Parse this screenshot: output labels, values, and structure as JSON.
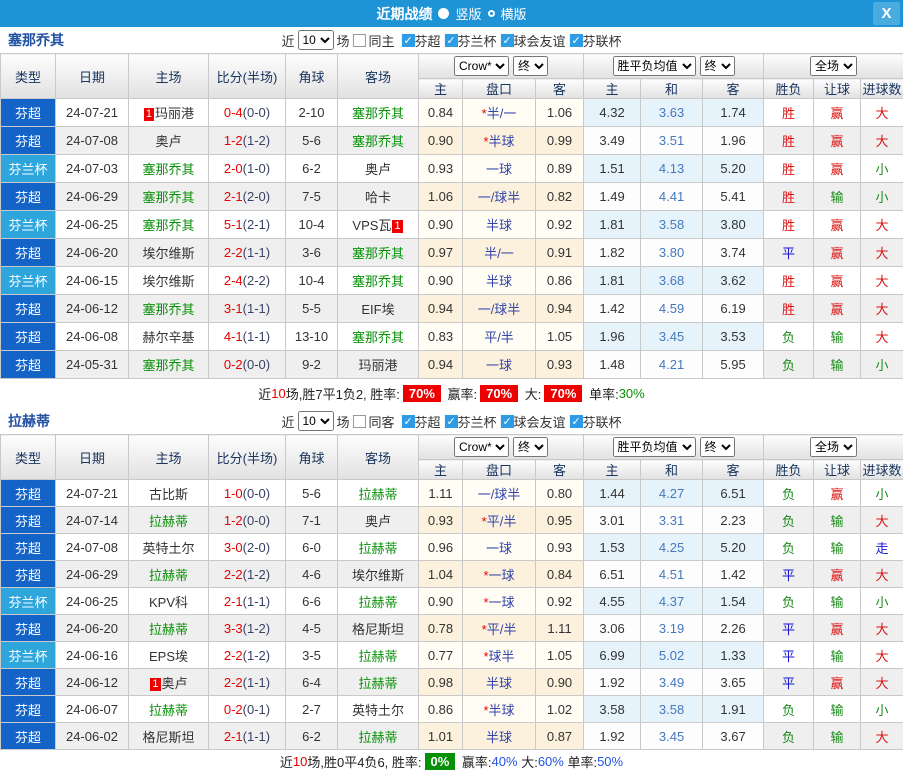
{
  "titlebar": {
    "title": "近期战绩",
    "radios": [
      {
        "label": "竖版",
        "selected": true
      },
      {
        "label": "横版",
        "selected": false
      }
    ],
    "close_label": "X"
  },
  "table_header": {
    "cols": [
      "类型",
      "日期",
      "主场",
      "比分(半场)",
      "角球",
      "客场"
    ],
    "sub": [
      "主",
      "盘口",
      "客",
      "主",
      "和",
      "客",
      "胜负",
      "让球",
      "进球数"
    ],
    "selects": {
      "company": "Crow*",
      "company_state": "终",
      "avg": "胜平负均值",
      "avg_state": "终",
      "scope": "全场"
    }
  },
  "colors": {
    "league_deep": "#1464c8",
    "league_light": "#2ea6dc",
    "self_team_green": "#089008",
    "win_red": "#dc1414",
    "draw_blue": "#1414d2",
    "lose_green": "#1a8a1a",
    "titlebar_blue": "#1e93d6"
  },
  "sections": [
    {
      "team": "塞那乔其",
      "filters": {
        "prefix": "近",
        "count": "10",
        "suffix": "场",
        "same_label": "同主",
        "same_checked": false,
        "leagues": [
          {
            "label": "芬超",
            "checked": true
          },
          {
            "label": "芬兰杯",
            "checked": true
          },
          {
            "label": "球会友谊",
            "checked": true
          },
          {
            "label": "芬联杯",
            "checked": true
          }
        ]
      },
      "rows": [
        {
          "league": "芬超",
          "league_type": "deep",
          "date": "24-07-21",
          "home": {
            "name": "玛丽港",
            "self": false,
            "badge": "1",
            "badge_pos": "before"
          },
          "score": "0-4",
          "half": "(0-0)",
          "corner": "2-10",
          "away": {
            "name": "塞那乔其",
            "self": true
          },
          "odds": [
            "0.84",
            "*半/一",
            "1.06"
          ],
          "avg": [
            "4.32",
            "3.63",
            "1.74"
          ],
          "results": [
            {
              "t": "胜",
              "c": "red"
            },
            {
              "t": "赢",
              "c": "red"
            },
            {
              "t": "大",
              "c": "red"
            }
          ]
        },
        {
          "league": "芬超",
          "league_type": "deep",
          "date": "24-07-08",
          "home": {
            "name": "奥卢",
            "self": false
          },
          "score": "1-2",
          "half": "(1-2)",
          "corner": "5-6",
          "away": {
            "name": "塞那乔其",
            "self": true
          },
          "odds": [
            "0.90",
            "*半球",
            "0.99"
          ],
          "avg": [
            "3.49",
            "3.51",
            "1.96"
          ],
          "results": [
            {
              "t": "胜",
              "c": "red"
            },
            {
              "t": "赢",
              "c": "red"
            },
            {
              "t": "大",
              "c": "red"
            }
          ]
        },
        {
          "league": "芬兰杯",
          "league_type": "light",
          "date": "24-07-03",
          "home": {
            "name": "塞那乔其",
            "self": true
          },
          "score": "2-0",
          "half": "(1-0)",
          "corner": "6-2",
          "away": {
            "name": "奥卢",
            "self": false
          },
          "odds": [
            "0.93",
            "一球",
            "0.89"
          ],
          "avg": [
            "1.51",
            "4.13",
            "5.20"
          ],
          "results": [
            {
              "t": "胜",
              "c": "red"
            },
            {
              "t": "赢",
              "c": "red"
            },
            {
              "t": "小",
              "c": "green"
            }
          ]
        },
        {
          "league": "芬超",
          "league_type": "deep",
          "date": "24-06-29",
          "home": {
            "name": "塞那乔其",
            "self": true
          },
          "score": "2-1",
          "half": "(2-0)",
          "corner": "7-5",
          "away": {
            "name": "哈卡",
            "self": false
          },
          "odds": [
            "1.06",
            "一/球半",
            "0.82"
          ],
          "avg": [
            "1.49",
            "4.41",
            "5.41"
          ],
          "results": [
            {
              "t": "胜",
              "c": "red"
            },
            {
              "t": "输",
              "c": "green"
            },
            {
              "t": "小",
              "c": "green"
            }
          ]
        },
        {
          "league": "芬兰杯",
          "league_type": "light",
          "date": "24-06-25",
          "home": {
            "name": "塞那乔其",
            "self": true
          },
          "score": "5-1",
          "half": "(2-1)",
          "corner": "10-4",
          "away": {
            "name": "VPS瓦",
            "self": false,
            "badge": "1",
            "badge_pos": "after"
          },
          "odds": [
            "0.90",
            "半球",
            "0.92"
          ],
          "avg": [
            "1.81",
            "3.58",
            "3.80"
          ],
          "results": [
            {
              "t": "胜",
              "c": "red"
            },
            {
              "t": "赢",
              "c": "red"
            },
            {
              "t": "大",
              "c": "red"
            }
          ]
        },
        {
          "league": "芬超",
          "league_type": "deep",
          "date": "24-06-20",
          "home": {
            "name": "埃尔维斯",
            "self": false
          },
          "score": "2-2",
          "half": "(1-1)",
          "corner": "3-6",
          "away": {
            "name": "塞那乔其",
            "self": true
          },
          "odds": [
            "0.97",
            "半/一",
            "0.91"
          ],
          "avg": [
            "1.82",
            "3.80",
            "3.74"
          ],
          "results": [
            {
              "t": "平",
              "c": "blue"
            },
            {
              "t": "赢",
              "c": "red"
            },
            {
              "t": "大",
              "c": "red"
            }
          ]
        },
        {
          "league": "芬兰杯",
          "league_type": "light",
          "date": "24-06-15",
          "home": {
            "name": "埃尔维斯",
            "self": false
          },
          "score": "2-4",
          "half": "(2-2)",
          "corner": "10-4",
          "away": {
            "name": "塞那乔其",
            "self": true
          },
          "odds": [
            "0.90",
            "半球",
            "0.86"
          ],
          "avg": [
            "1.81",
            "3.68",
            "3.62"
          ],
          "results": [
            {
              "t": "胜",
              "c": "red"
            },
            {
              "t": "赢",
              "c": "red"
            },
            {
              "t": "大",
              "c": "red"
            }
          ]
        },
        {
          "league": "芬超",
          "league_type": "deep",
          "date": "24-06-12",
          "home": {
            "name": "塞那乔其",
            "self": true
          },
          "score": "3-1",
          "half": "(1-1)",
          "corner": "5-5",
          "away": {
            "name": "EIF埃",
            "self": false
          },
          "odds": [
            "0.94",
            "一/球半",
            "0.94"
          ],
          "avg": [
            "1.42",
            "4.59",
            "6.19"
          ],
          "results": [
            {
              "t": "胜",
              "c": "red"
            },
            {
              "t": "赢",
              "c": "red"
            },
            {
              "t": "大",
              "c": "red"
            }
          ]
        },
        {
          "league": "芬超",
          "league_type": "deep",
          "date": "24-06-08",
          "home": {
            "name": "赫尔辛基",
            "self": false
          },
          "score": "4-1",
          "half": "(1-1)",
          "corner": "13-10",
          "away": {
            "name": "塞那乔其",
            "self": true
          },
          "odds": [
            "0.83",
            "平/半",
            "1.05"
          ],
          "avg": [
            "1.96",
            "3.45",
            "3.53"
          ],
          "results": [
            {
              "t": "负",
              "c": "green"
            },
            {
              "t": "输",
              "c": "green"
            },
            {
              "t": "大",
              "c": "red"
            }
          ]
        },
        {
          "league": "芬超",
          "league_type": "deep",
          "date": "24-05-31",
          "home": {
            "name": "塞那乔其",
            "self": true
          },
          "score": "0-2",
          "half": "(0-0)",
          "corner": "9-2",
          "away": {
            "name": "玛丽港",
            "self": false
          },
          "odds": [
            "0.94",
            "一球",
            "0.93"
          ],
          "avg": [
            "1.48",
            "4.21",
            "5.95"
          ],
          "results": [
            {
              "t": "负",
              "c": "green"
            },
            {
              "t": "输",
              "c": "green"
            },
            {
              "t": "小",
              "c": "green"
            }
          ]
        }
      ],
      "summary": [
        {
          "t": "近"
        },
        {
          "t": "10",
          "c": "red"
        },
        {
          "t": "场,胜7平1负2, 胜率:"
        },
        {
          "t": "70%",
          "c": "badge-red"
        },
        {
          "t": " 赢率:"
        },
        {
          "t": "70%",
          "c": "badge-red"
        },
        {
          "t": " 大:"
        },
        {
          "t": "70%",
          "c": "badge-red"
        },
        {
          "t": " 单率:"
        },
        {
          "t": "30%",
          "c": "green"
        }
      ]
    },
    {
      "team": "拉赫蒂",
      "filters": {
        "prefix": "近",
        "count": "10",
        "suffix": "场",
        "same_label": "同客",
        "same_checked": false,
        "leagues": [
          {
            "label": "芬超",
            "checked": true
          },
          {
            "label": "芬兰杯",
            "checked": true
          },
          {
            "label": "球会友谊",
            "checked": true
          },
          {
            "label": "芬联杯",
            "checked": true
          }
        ]
      },
      "rows": [
        {
          "league": "芬超",
          "league_type": "deep",
          "date": "24-07-21",
          "home": {
            "name": "古比斯",
            "self": false
          },
          "score": "1-0",
          "half": "(0-0)",
          "corner": "5-6",
          "away": {
            "name": "拉赫蒂",
            "self": true
          },
          "odds": [
            "1.11",
            "一/球半",
            "0.80"
          ],
          "avg": [
            "1.44",
            "4.27",
            "6.51"
          ],
          "results": [
            {
              "t": "负",
              "c": "green"
            },
            {
              "t": "赢",
              "c": "red"
            },
            {
              "t": "小",
              "c": "green"
            }
          ]
        },
        {
          "league": "芬超",
          "league_type": "deep",
          "date": "24-07-14",
          "home": {
            "name": "拉赫蒂",
            "self": true
          },
          "score": "1-2",
          "half": "(0-0)",
          "corner": "7-1",
          "away": {
            "name": "奥卢",
            "self": false
          },
          "odds": [
            "0.93",
            "*平/半",
            "0.95"
          ],
          "avg": [
            "3.01",
            "3.31",
            "2.23"
          ],
          "results": [
            {
              "t": "负",
              "c": "green"
            },
            {
              "t": "输",
              "c": "green"
            },
            {
              "t": "大",
              "c": "red"
            }
          ]
        },
        {
          "league": "芬超",
          "league_type": "deep",
          "date": "24-07-08",
          "home": {
            "name": "英特土尔",
            "self": false
          },
          "score": "3-0",
          "half": "(2-0)",
          "corner": "6-0",
          "away": {
            "name": "拉赫蒂",
            "self": true
          },
          "odds": [
            "0.96",
            "一球",
            "0.93"
          ],
          "avg": [
            "1.53",
            "4.25",
            "5.20"
          ],
          "results": [
            {
              "t": "负",
              "c": "green"
            },
            {
              "t": "输",
              "c": "green"
            },
            {
              "t": "走",
              "c": "blue"
            }
          ]
        },
        {
          "league": "芬超",
          "league_type": "deep",
          "date": "24-06-29",
          "home": {
            "name": "拉赫蒂",
            "self": true
          },
          "score": "2-2",
          "half": "(1-2)",
          "corner": "4-6",
          "away": {
            "name": "埃尔维斯",
            "self": false
          },
          "odds": [
            "1.04",
            "*一球",
            "0.84"
          ],
          "avg": [
            "6.51",
            "4.51",
            "1.42"
          ],
          "results": [
            {
              "t": "平",
              "c": "blue"
            },
            {
              "t": "赢",
              "c": "red"
            },
            {
              "t": "大",
              "c": "red"
            }
          ]
        },
        {
          "league": "芬兰杯",
          "league_type": "light",
          "date": "24-06-25",
          "home": {
            "name": "KPV科",
            "self": false
          },
          "score": "2-1",
          "half": "(1-1)",
          "corner": "6-6",
          "away": {
            "name": "拉赫蒂",
            "self": true
          },
          "odds": [
            "0.90",
            "*一球",
            "0.92"
          ],
          "avg": [
            "4.55",
            "4.37",
            "1.54"
          ],
          "results": [
            {
              "t": "负",
              "c": "green"
            },
            {
              "t": "输",
              "c": "green"
            },
            {
              "t": "小",
              "c": "green"
            }
          ]
        },
        {
          "league": "芬超",
          "league_type": "deep",
          "date": "24-06-20",
          "home": {
            "name": "拉赫蒂",
            "self": true
          },
          "score": "3-3",
          "half": "(1-2)",
          "corner": "4-5",
          "away": {
            "name": "格尼斯坦",
            "self": false
          },
          "odds": [
            "0.78",
            "*平/半",
            "1.11"
          ],
          "avg": [
            "3.06",
            "3.19",
            "2.26"
          ],
          "results": [
            {
              "t": "平",
              "c": "blue"
            },
            {
              "t": "赢",
              "c": "red"
            },
            {
              "t": "大",
              "c": "red"
            }
          ]
        },
        {
          "league": "芬兰杯",
          "league_type": "light",
          "date": "24-06-16",
          "home": {
            "name": "EPS埃",
            "self": false
          },
          "score": "2-2",
          "half": "(1-2)",
          "corner": "3-5",
          "away": {
            "name": "拉赫蒂",
            "self": true
          },
          "odds": [
            "0.77",
            "*球半",
            "1.05"
          ],
          "avg": [
            "6.99",
            "5.02",
            "1.33"
          ],
          "results": [
            {
              "t": "平",
              "c": "blue"
            },
            {
              "t": "输",
              "c": "green"
            },
            {
              "t": "大",
              "c": "red"
            }
          ]
        },
        {
          "league": "芬超",
          "league_type": "deep",
          "date": "24-06-12",
          "home": {
            "name": "奥卢",
            "self": false,
            "badge": "1",
            "badge_pos": "before"
          },
          "score": "2-2",
          "half": "(1-1)",
          "corner": "6-4",
          "away": {
            "name": "拉赫蒂",
            "self": true
          },
          "odds": [
            "0.98",
            "半球",
            "0.90"
          ],
          "avg": [
            "1.92",
            "3.49",
            "3.65"
          ],
          "results": [
            {
              "t": "平",
              "c": "blue"
            },
            {
              "t": "赢",
              "c": "red"
            },
            {
              "t": "大",
              "c": "red"
            }
          ]
        },
        {
          "league": "芬超",
          "league_type": "deep",
          "date": "24-06-07",
          "home": {
            "name": "拉赫蒂",
            "self": true
          },
          "score": "0-2",
          "half": "(0-1)",
          "corner": "2-7",
          "away": {
            "name": "英特土尔",
            "self": false
          },
          "odds": [
            "0.86",
            "*半球",
            "1.02"
          ],
          "avg": [
            "3.58",
            "3.58",
            "1.91"
          ],
          "results": [
            {
              "t": "负",
              "c": "green"
            },
            {
              "t": "输",
              "c": "green"
            },
            {
              "t": "小",
              "c": "green"
            }
          ]
        },
        {
          "league": "芬超",
          "league_type": "deep",
          "date": "24-06-02",
          "home": {
            "name": "格尼斯坦",
            "self": false
          },
          "score": "2-1",
          "half": "(1-1)",
          "corner": "6-2",
          "away": {
            "name": "拉赫蒂",
            "self": true
          },
          "odds": [
            "1.01",
            "半球",
            "0.87"
          ],
          "avg": [
            "1.92",
            "3.45",
            "3.67"
          ],
          "results": [
            {
              "t": "负",
              "c": "green"
            },
            {
              "t": "输",
              "c": "green"
            },
            {
              "t": "大",
              "c": "red"
            }
          ]
        }
      ],
      "summary": [
        {
          "t": "近"
        },
        {
          "t": "10",
          "c": "red"
        },
        {
          "t": "场,胜0平4负6, 胜率:"
        },
        {
          "t": "0%",
          "c": "badge-green"
        },
        {
          "t": " 赢率:"
        },
        {
          "t": "40%",
          "c": "blue"
        },
        {
          "t": " 大:"
        },
        {
          "t": "60%",
          "c": "blue"
        },
        {
          "t": " 单率:"
        },
        {
          "t": "50%",
          "c": "blue"
        }
      ]
    }
  ]
}
